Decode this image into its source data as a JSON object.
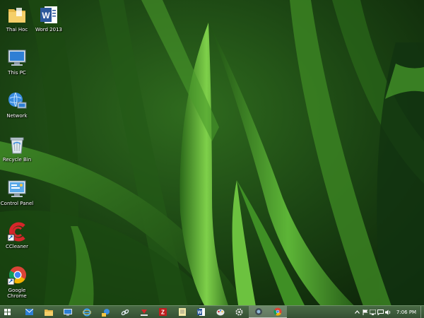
{
  "desktop": {
    "icons": [
      {
        "label": "Thai Hoc",
        "icon": "folder-icon"
      },
      {
        "label": "Word 2013",
        "icon": "word-icon"
      },
      {
        "label": "This PC",
        "icon": "computer-icon"
      },
      {
        "label": "Network",
        "icon": "network-icon"
      },
      {
        "label": "Recycle Bin",
        "icon": "recycle-bin-icon"
      },
      {
        "label": "Control Panel",
        "icon": "control-panel-icon"
      },
      {
        "label": "CCleaner",
        "icon": "ccleaner-icon"
      },
      {
        "label": "Google Chrome",
        "icon": "chrome-icon"
      }
    ]
  },
  "taskbar": {
    "apps": [
      {
        "name": "mail-icon"
      },
      {
        "name": "file-explorer-icon"
      },
      {
        "name": "remote-desktop-icon"
      },
      {
        "name": "internet-explorer-icon"
      },
      {
        "name": "network-tool-icon"
      },
      {
        "name": "link-icon"
      },
      {
        "name": "download-manager-icon"
      },
      {
        "name": "filezilla-icon"
      },
      {
        "name": "notepad-icon"
      },
      {
        "name": "word-icon"
      },
      {
        "name": "paint-icon"
      },
      {
        "name": "gear-icon"
      },
      {
        "name": "camera-app-icon"
      },
      {
        "name": "chrome-icon"
      }
    ],
    "tray": {
      "icons": [
        "show-hidden-icons-icon",
        "flag-icon",
        "network-icon",
        "chat-icon",
        "volume-icon"
      ],
      "time": "7:06 PM"
    }
  },
  "colors": {
    "wallpaper_dark": "#0f2a0c",
    "wallpaper_light": "#7fcf4a",
    "taskbar": "#3f5d3c"
  }
}
